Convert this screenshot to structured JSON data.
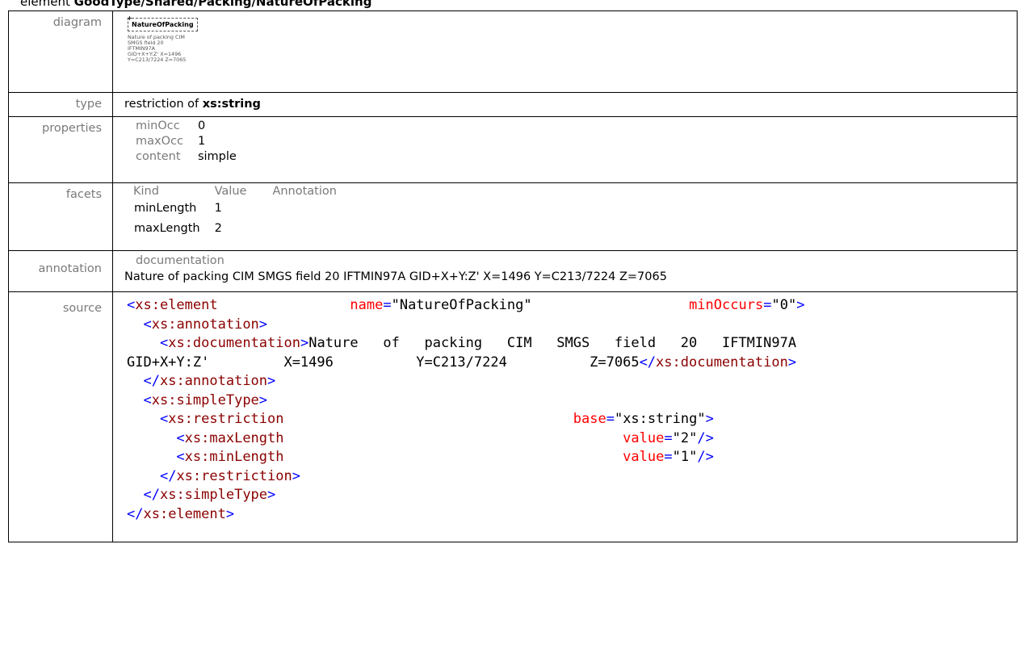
{
  "heading": {
    "prefix": "element",
    "path": "GoodType/Shared/Packing/NatureOfPacking"
  },
  "rows": {
    "diagram": {
      "label": "diagram",
      "element_name": "NatureOfPacking",
      "doc_lines": "Nature of packing CIM\nSMGS field 20\nIFTMIN97A\nGID+X+Y:Z' X=1496\nY=C213/7224 Z=7065"
    },
    "type": {
      "label": "type",
      "prefix": "restriction of",
      "base": "xs:string"
    },
    "properties": {
      "label": "properties",
      "items": [
        {
          "key": "minOcc",
          "value": "0"
        },
        {
          "key": "maxOcc",
          "value": "1"
        },
        {
          "key": "content",
          "value": "simple"
        }
      ]
    },
    "facets": {
      "label": "facets",
      "headers": [
        "Kind",
        "Value",
        "Annotation"
      ],
      "items": [
        {
          "kind": "minLength",
          "value": "1",
          "annotation": ""
        },
        {
          "kind": "maxLength",
          "value": "2",
          "annotation": ""
        }
      ]
    },
    "annotation": {
      "label": "annotation",
      "sub_label": "documentation",
      "text": "Nature of packing CIM SMGS field 20 IFTMIN97A GID+X+Y:Z' X=1496 Y=C213/7224 Z=7065"
    },
    "source": {
      "label": "source",
      "element_name_attr": "NatureOfPacking",
      "min_occurs": "0",
      "doc_line1": "Nature   of   packing   CIM   SMGS   field   20   IFTMIN97A",
      "doc_line2": "GID+X+Y:Z'         X=1496          Y=C213/7224          Z=7065",
      "base": "xs:string",
      "max_length": "2",
      "min_length": "1"
    }
  }
}
